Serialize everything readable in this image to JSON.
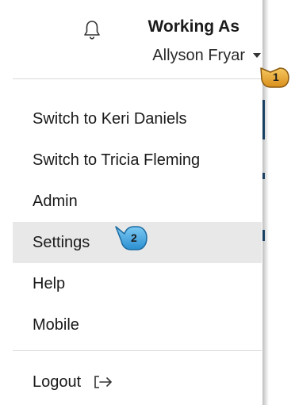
{
  "header": {
    "working_as_label": "Working As",
    "user_name": "Allyson Fryar",
    "notification_icon": "bell-icon"
  },
  "menu": {
    "items": [
      {
        "label": "Switch to Keri Daniels"
      },
      {
        "label": "Switch to Tricia Fleming"
      },
      {
        "label": "Admin"
      },
      {
        "label": "Settings"
      },
      {
        "label": "Help"
      },
      {
        "label": "Mobile"
      }
    ],
    "logout_label": "Logout",
    "logout_icon": "logout-arrow-icon"
  },
  "callouts": {
    "step1": "1",
    "step2": "2"
  },
  "colors": {
    "highlight": "#e8e8e8",
    "callout_gold": "#e8a530",
    "callout_blue": "#3da7e0",
    "edge_blue": "#1f4f7a"
  }
}
